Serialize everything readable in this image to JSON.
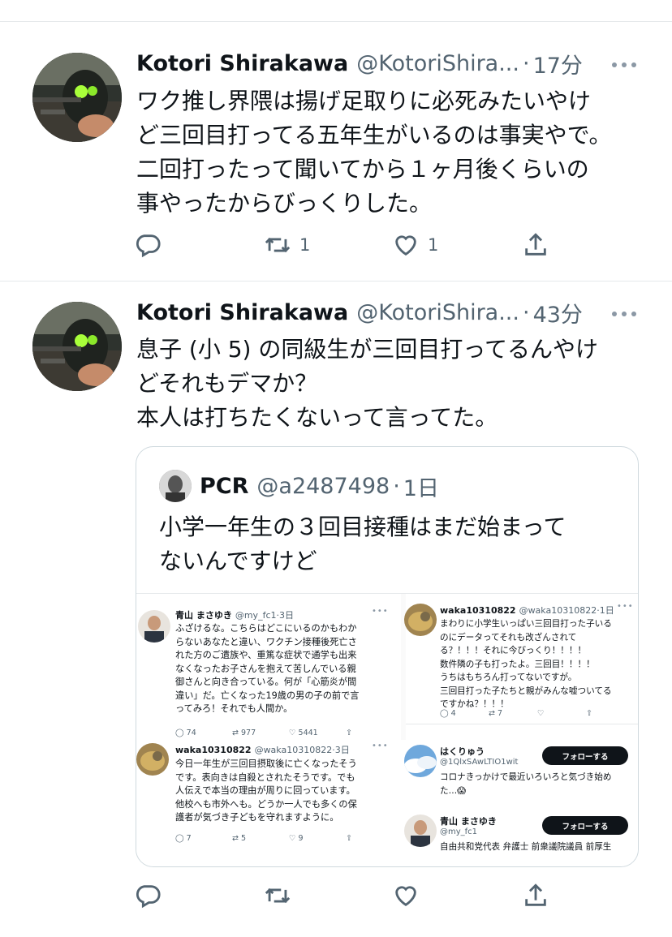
{
  "tweets": [
    {
      "name": "Kotori Shirakawa",
      "handle": "@KotoriShira...",
      "dot": "·",
      "time": "17分",
      "text": "ワク推し界隈は揚げ足取りに必死みたいやけ\nど三回目打ってる五年生がいるのは事実やで。\n二回打ったって聞いてから１ヶ月後くらいの\n事やったからびっくりした。",
      "replies": "",
      "retweets": "1",
      "likes": "1"
    },
    {
      "name": "Kotori Shirakawa",
      "handle": "@KotoriShira...",
      "dot": "·",
      "time": "43分",
      "text": "息子 (小 5) の同級生が三回目打ってるんやけ\nどそれもデマか？\n本人は打ちたくないって言ってた。",
      "replies": "",
      "retweets": "",
      "likes": ""
    }
  ],
  "quote": {
    "name": "PCR",
    "handle": "@a2487498",
    "dot": "·",
    "time": "1日",
    "text": "小学一年生の３回目接種はまだ始まって\nないんですけど"
  },
  "embedded": {
    "p1": {
      "name": "青山 まさゆき",
      "handle": "@my_fc1·3日",
      "body": "ふざけるな。こちらはどこにいるのかもわか\nらないあなたと違い、ワクチン接種後死亡さ\nれた方のご遺族や、重篤な症状で通学も出来\nなくなったお子さんを抱えて苦しんでいる親\n御さんと向き合っている。何が「心筋炎が間\n違い」だ。亡くなった19歳の男の子の前で言\nってみろ！それでも人間か。",
      "replies": "74",
      "retweets": "977",
      "likes": "5441"
    },
    "p2": {
      "name": "waka10310822",
      "handle": "@waka10310822·1日",
      "body": "まわりに小学生いっぱい三回目打った子いる\nのにデータってそれも改ざんされて\nる？！！！それに今びっくり！！！！\n数件隣の子も打ったよ。三回目！！！！\nうちはもちろん打ってないですが。\n三回目打った子たちと親がみんな嘘ついてる\nですかね？！！！",
      "replies": "4",
      "retweets": "7",
      "likes": ""
    },
    "p3": {
      "name": "waka10310822",
      "handle": "@waka10310822·3日",
      "body": "今日一年生が三回目摂取後に亡くなったそう\nです。表向きは自殺とされたそうです。でも\n人伝えで本当の理由が周りに回っています。\n他校へも市外へも。どうか一人でも多くの保\n護者が気づき子どもを守れますように。",
      "replies": "7",
      "retweets": "5",
      "likes": "9"
    },
    "u1": {
      "name": "はくりゅう",
      "handle": "@1QlxSAwLTIO1wit",
      "bio": "コロナきっかけで最近いろいろと気づき始め\nた…😱",
      "follow": "フォローする"
    },
    "u2": {
      "name": "青山 まさゆき",
      "handle": "@my_fc1",
      "bio": "自由共和党代表 弁護士 前衆議院議員 前厚生",
      "follow": "フォローする"
    }
  },
  "icons": {
    "reply": "reply-icon",
    "retweet": "retweet-icon",
    "like": "heart-icon",
    "share": "share-icon",
    "more": "more-icon"
  }
}
